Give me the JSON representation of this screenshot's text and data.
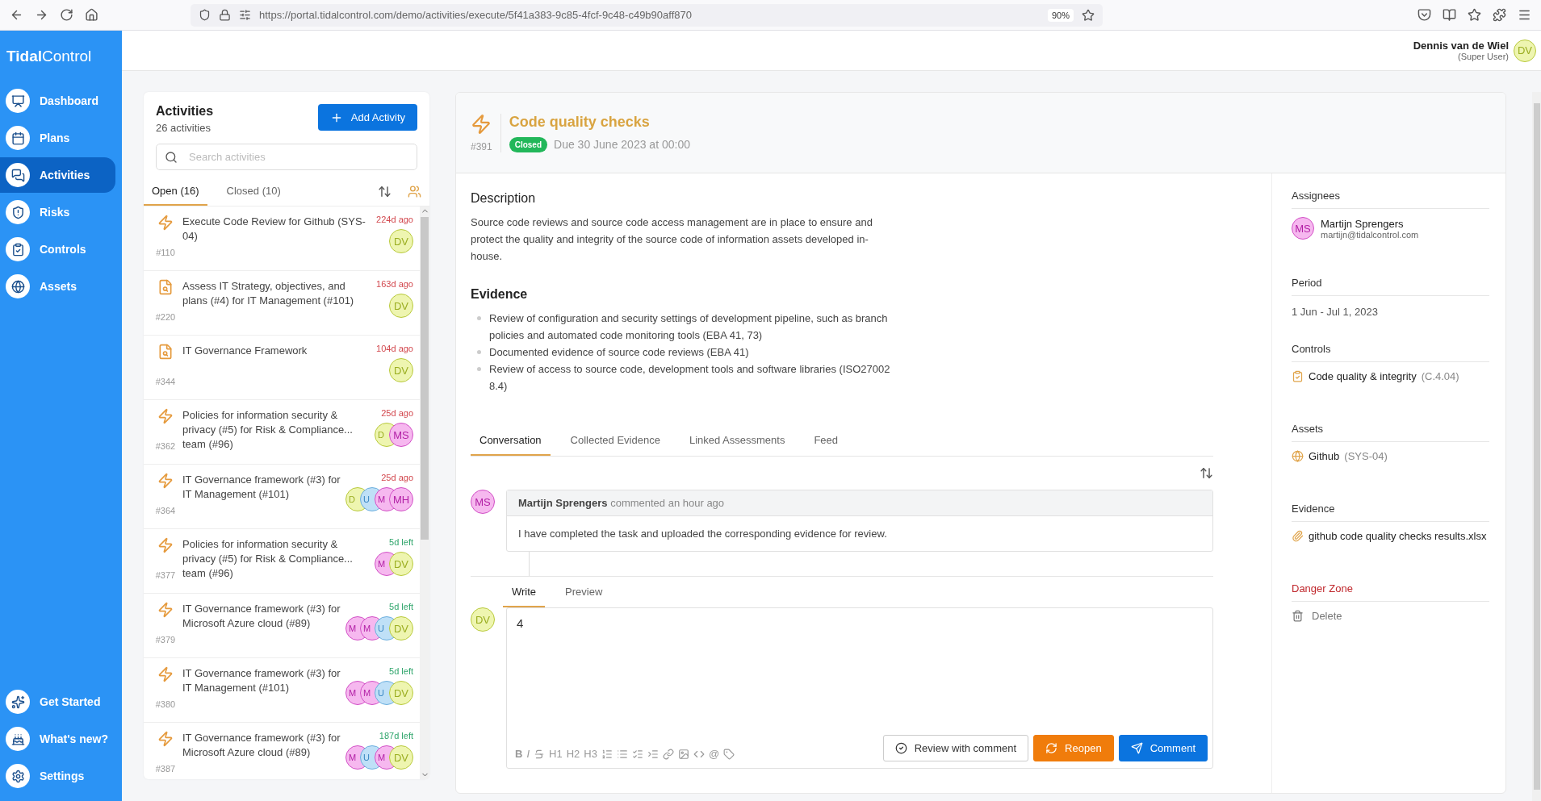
{
  "browser": {
    "url": "https://portal.tidalcontrol.com/demo/activities/execute/5f41a383-9c85-4fcf-9c48-c49b90aff870",
    "zoom": "90%"
  },
  "brand": {
    "name_bold": "Tidal",
    "name_light": "Control"
  },
  "user": {
    "name": "Dennis van de Wiel",
    "role": "(Super User)",
    "initials": "DV"
  },
  "sidebar": {
    "items": [
      {
        "label": "Dashboard",
        "selected": false
      },
      {
        "label": "Plans",
        "selected": false
      },
      {
        "label": "Activities",
        "selected": true
      },
      {
        "label": "Risks",
        "selected": false
      },
      {
        "label": "Controls",
        "selected": false
      },
      {
        "label": "Assets",
        "selected": false
      }
    ],
    "bottom_items": [
      {
        "label": "Get Started"
      },
      {
        "label": "What's new?"
      },
      {
        "label": "Settings"
      }
    ]
  },
  "activities": {
    "title": "Activities",
    "count": "26 activities",
    "add_button": "Add Activity",
    "search": {
      "placeholder": "Search activities"
    },
    "tabs": [
      {
        "label": "Open (16)",
        "selected": true
      },
      {
        "label": "Closed (10)",
        "selected": false
      }
    ],
    "items": [
      {
        "kind": "task",
        "title": "Execute Code Review for Github (SYS-04)",
        "number": "#110",
        "due": "224d ago",
        "overdue": true,
        "avatars": [
          {
            "initials": "DV",
            "color": "#eef5b0"
          }
        ]
      },
      {
        "kind": "document",
        "title": "Assess IT Strategy, objectives, and plans (#4) for IT Management (#101)",
        "number": "#220",
        "due": "163d ago",
        "overdue": true,
        "avatars": [
          {
            "initials": "DV",
            "color": "#eef5b0"
          }
        ]
      },
      {
        "kind": "document",
        "title": "IT Governance Framework",
        "number": "#344",
        "due": "104d ago",
        "overdue": true,
        "avatars": [
          {
            "initials": "DV",
            "color": "#eef5b0"
          }
        ]
      },
      {
        "kind": "task",
        "title": "Policies for information security & privacy (#5) for Risk & Compliance... team (#96)",
        "number": "#362",
        "due": "25d ago",
        "overdue": true,
        "avatars": [
          {
            "initials": "D",
            "color": "#eef5b0"
          },
          {
            "initials": "MS",
            "color": "#f6b8ef"
          }
        ]
      },
      {
        "kind": "task",
        "title": "IT Governance framework (#3) for IT Management (#101)",
        "number": "#364",
        "due": "25d ago",
        "overdue": true,
        "avatars": [
          {
            "initials": "D",
            "color": "#eef5b0"
          },
          {
            "initials": "U",
            "color": "#bfe0f7"
          },
          {
            "initials": "M",
            "color": "#f6b8ef"
          },
          {
            "initials": "MH",
            "color": "#f6b8ef"
          }
        ]
      },
      {
        "kind": "task",
        "title": "Policies for information security & privacy (#5) for Risk & Compliance... team (#96)",
        "number": "#377",
        "due": "5d left",
        "overdue": false,
        "avatars": [
          {
            "initials": "M",
            "color": "#f6b8ef"
          },
          {
            "initials": "DV",
            "color": "#eef5b0"
          }
        ]
      },
      {
        "kind": "task",
        "title": "IT Governance framework (#3) for Microsoft Azure cloud (#89)",
        "number": "#379",
        "due": "5d left",
        "overdue": false,
        "avatars": [
          {
            "initials": "M",
            "color": "#f6b8ef"
          },
          {
            "initials": "M",
            "color": "#f6b8ef"
          },
          {
            "initials": "U",
            "color": "#bfe0f7"
          },
          {
            "initials": "DV",
            "color": "#eef5b0"
          }
        ]
      },
      {
        "kind": "task",
        "title": "IT Governance framework (#3) for IT Management (#101)",
        "number": "#380",
        "due": "5d left",
        "overdue": false,
        "avatars": [
          {
            "initials": "M",
            "color": "#f6b8ef"
          },
          {
            "initials": "M",
            "color": "#f6b8ef"
          },
          {
            "initials": "U",
            "color": "#bfe0f7"
          },
          {
            "initials": "DV",
            "color": "#eef5b0"
          }
        ]
      },
      {
        "kind": "task",
        "title": "IT Governance framework (#3) for Microsoft Azure cloud (#89)",
        "number": "#387",
        "due": "187d left",
        "overdue": false,
        "avatars": [
          {
            "initials": "M",
            "color": "#f6b8ef"
          },
          {
            "initials": "U",
            "color": "#bfe0f7"
          },
          {
            "initials": "M",
            "color": "#f6b8ef"
          },
          {
            "initials": "DV",
            "color": "#eef5b0"
          }
        ]
      }
    ]
  },
  "detail": {
    "title": "Code quality checks",
    "number": "#391",
    "status": "Closed",
    "due": "Due 30 June 2023 at 00:00",
    "description_heading": "Description",
    "description": "Source code reviews and source code access management are in place to ensure and protect the quality and integrity of the source code of information assets developed in-house.",
    "evidence_heading": "Evidence",
    "evidence": [
      "Review of configuration and security settings of development pipeline, such as branch policies and automated code monitoring tools (EBA 41, 73)",
      "Documented evidence of source code reviews (EBA 41)",
      "Review of access to source code, development tools and software libraries (ISO27002 8.4)"
    ],
    "tabs": [
      {
        "label": "Conversation",
        "selected": true
      },
      {
        "label": "Collected Evidence",
        "selected": false
      },
      {
        "label": "Linked Assessments",
        "selected": false
      },
      {
        "label": "Feed",
        "selected": false
      }
    ],
    "comments": [
      {
        "initials": "MS",
        "color": "#f6b8ef",
        "author": "Martijn Sprengers",
        "meta": "commented an hour ago",
        "body": "I have completed the task and uploaded the corresponding evidence for review."
      }
    ],
    "editor": {
      "tabs": [
        {
          "label": "Write",
          "selected": true
        },
        {
          "label": "Preview",
          "selected": false
        }
      ],
      "initials": "DV",
      "value": "4",
      "format_labels": [
        "B",
        "I",
        "H1",
        "H2",
        "H3",
        "@"
      ],
      "buttons": [
        {
          "kind": "review",
          "label": "Review with comment"
        },
        {
          "kind": "reopen",
          "label": "Reopen"
        },
        {
          "kind": "comment",
          "label": "Comment"
        }
      ]
    }
  },
  "side": {
    "assignees_heading": "Assignees",
    "assignee": {
      "initials": "MS",
      "name": "Martijn Sprengers",
      "email": "martijn@tidalcontrol.com"
    },
    "period_heading": "Period",
    "period": "1 Jun - Jul 1, 2023",
    "controls_heading": "Controls",
    "control": {
      "name": "Code quality & integrity",
      "code": "(C.4.04)"
    },
    "assets_heading": "Assets",
    "asset": {
      "name": "Github",
      "code": "(SYS-04)"
    },
    "evidence_heading": "Evidence",
    "evidence_file": "github code quality checks results.xlsx",
    "danger_heading": "Danger Zone",
    "delete_label": "Delete"
  }
}
